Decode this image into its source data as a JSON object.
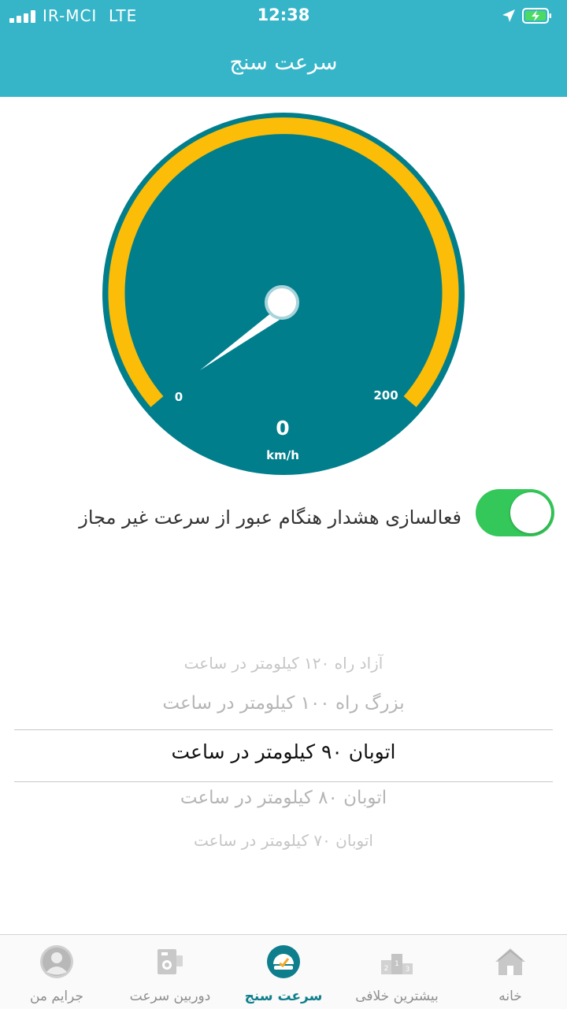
{
  "status_bar": {
    "carrier": "IR-MCI",
    "network": "LTE",
    "time": "12:38"
  },
  "header": {
    "title": "سرعت سنج"
  },
  "gauge": {
    "min_label": "0",
    "max_label": "200",
    "speed": "0",
    "unit": "km/h",
    "colors": {
      "dial": "#017e8c",
      "arc": "#fbbd08",
      "needle": "#ffffff"
    }
  },
  "alert": {
    "label": "فعالسازی هشدار هنگام عبور از سرعت غیر مجاز",
    "enabled": true
  },
  "speed_limits": {
    "items": [
      "آزاد راه ۱۲۰ کیلومتر در ساعت",
      "بزرگ راه ۱۰۰ کیلومتر در ساعت",
      "اتوبان ۹۰ کیلومتر در ساعت",
      "اتوبان ۸۰ کیلومتر در ساعت",
      "اتوبان ۷۰ کیلومتر در ساعت"
    ],
    "selected": "اتوبان ۹۰ کیلومتر در ساعت"
  },
  "tabs": [
    {
      "label": "جرایم من",
      "icon": "avatar-icon"
    },
    {
      "label": "دوربین سرعت",
      "icon": "camera-icon"
    },
    {
      "label": "سرعت سنج",
      "icon": "speedometer-icon",
      "active": true
    },
    {
      "label": "بیشترین خلافی",
      "icon": "podium-icon"
    },
    {
      "label": "خانه",
      "icon": "home-icon"
    }
  ]
}
